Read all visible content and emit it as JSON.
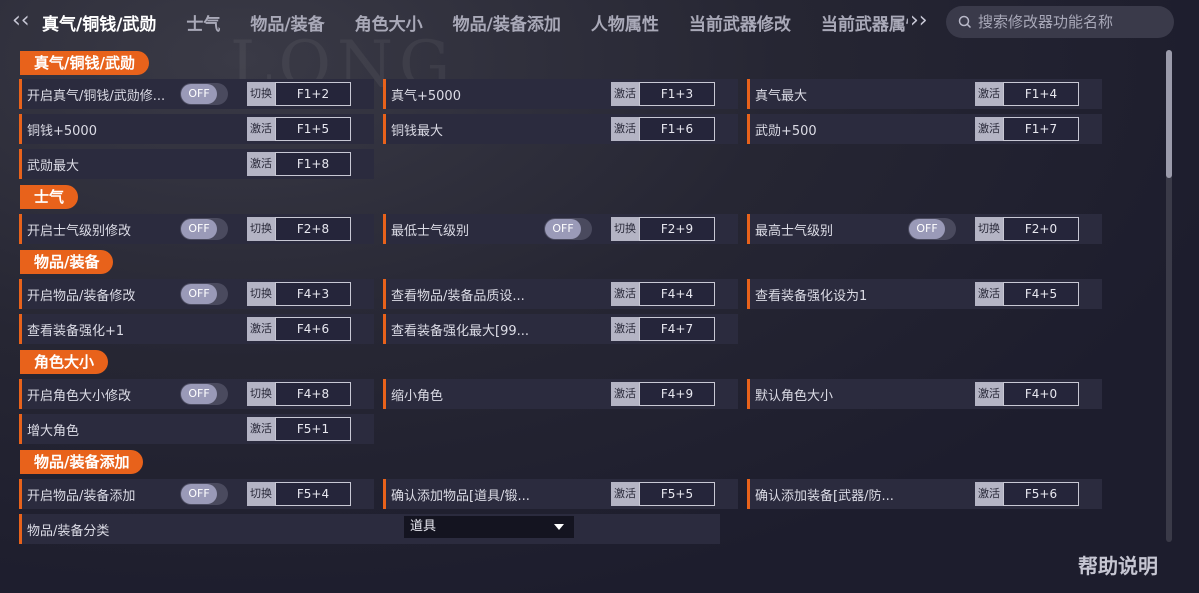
{
  "nav": {
    "tabs": [
      "真气/铜钱/武勋",
      "士气",
      "物品/装备",
      "角色大小",
      "物品/装备添加",
      "人物属性",
      "当前武器修改",
      "当前武器属性"
    ],
    "search_placeholder": "搜索修改器功能名称"
  },
  "toggle_label": "OFF",
  "sections": [
    {
      "title": "真气/铜钱/武勋",
      "rows": [
        {
          "label": "开启真气/铜钱/武勋修...",
          "toggle": true,
          "action": "切换",
          "key": "F1+2"
        },
        {
          "label": "真气+5000",
          "action": "激活",
          "key": "F1+3"
        },
        {
          "label": "真气最大",
          "action": "激活",
          "key": "F1+4"
        },
        {
          "label": "铜钱+5000",
          "action": "激活",
          "key": "F1+5"
        },
        {
          "label": "铜钱最大",
          "action": "激活",
          "key": "F1+6"
        },
        {
          "label": "武勋+500",
          "action": "激活",
          "key": "F1+7"
        },
        {
          "label": "武勋最大",
          "action": "激活",
          "key": "F1+8"
        }
      ]
    },
    {
      "title": "士气",
      "rows": [
        {
          "label": "开启士气级别修改",
          "toggle": true,
          "action": "切换",
          "key": "F2+8"
        },
        {
          "label": "最低士气级别",
          "toggle": true,
          "action": "切换",
          "key": "F2+9"
        },
        {
          "label": "最高士气级别",
          "toggle": true,
          "action": "切换",
          "key": "F2+0"
        }
      ]
    },
    {
      "title": "物品/装备",
      "rows": [
        {
          "label": "开启物品/装备修改",
          "toggle": true,
          "action": "切换",
          "key": "F4+3"
        },
        {
          "label": "查看物品/装备品质设...",
          "action": "激活",
          "key": "F4+4"
        },
        {
          "label": "查看装备强化设为1",
          "action": "激活",
          "key": "F4+5"
        },
        {
          "label": "查看装备强化+1",
          "action": "激活",
          "key": "F4+6"
        },
        {
          "label": "查看装备强化最大[99...",
          "action": "激活",
          "key": "F4+7"
        }
      ]
    },
    {
      "title": "角色大小",
      "rows": [
        {
          "label": "开启角色大小修改",
          "toggle": true,
          "action": "切换",
          "key": "F4+8"
        },
        {
          "label": "缩小角色",
          "action": "激活",
          "key": "F4+9"
        },
        {
          "label": "默认角色大小",
          "action": "激活",
          "key": "F4+0"
        },
        {
          "label": "增大角色",
          "action": "激活",
          "key": "F5+1"
        }
      ]
    },
    {
      "title": "物品/装备添加",
      "rows": [
        {
          "label": "开启物品/装备添加",
          "toggle": true,
          "action": "切换",
          "key": "F5+4"
        },
        {
          "label": "确认添加物品[道具/锻...",
          "action": "激活",
          "key": "F5+5"
        },
        {
          "label": "确认添加装备[武器/防...",
          "action": "激活",
          "key": "F5+6"
        },
        {
          "label": "物品/装备分类",
          "dropdown": "道具"
        }
      ]
    }
  ],
  "help_label": "帮助说明",
  "colors": {
    "accent": "#e8621b",
    "row_bg": "#2b2b3e",
    "background": "#1d1d2d"
  }
}
